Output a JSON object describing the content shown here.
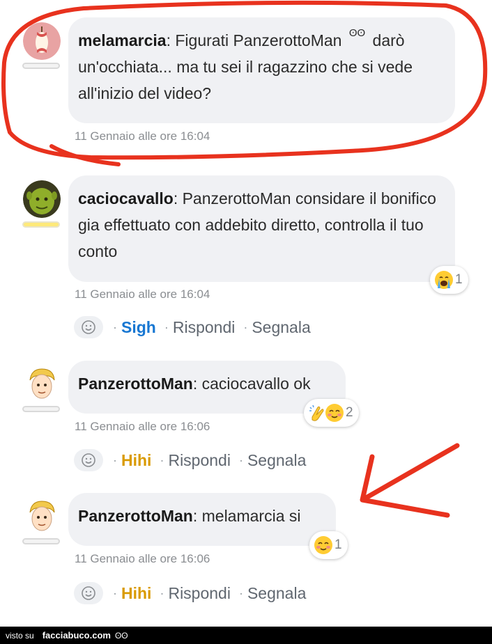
{
  "comments": [
    {
      "author": "melamarcia",
      "text_a": ": Figurati PanzerottoMan ",
      "eyes": "ʘʘ",
      "text_b": " darò un'occhiata... ma tu sei il ragazzino che si vede all'inizio del video?",
      "timestamp": "11 Gennaio alle ore 16:04"
    },
    {
      "author": "caciocavallo",
      "text": ": PanzerottoMan considare il bonifico gia effettuato con addebito diretto, controlla il tuo conto",
      "timestamp": "11 Gennaio alle ore 16:04",
      "reaction_count": "1",
      "reaction_emoji": "crying-face",
      "vote_label": "Sigh",
      "reply_label": "Rispondi",
      "report_label": "Segnala",
      "sep": "·"
    },
    {
      "author": "PanzerottoMan",
      "text": ": caciocavallo ok",
      "timestamp": "11 Gennaio alle ore 16:06",
      "reaction_count": "2",
      "reaction_emoji": [
        "clapping-hands",
        "blushing-face"
      ],
      "vote_label": "Hihi",
      "reply_label": "Rispondi",
      "report_label": "Segnala",
      "sep": "·"
    },
    {
      "author": "PanzerottoMan",
      "text": ": melamarcia si",
      "timestamp": "11 Gennaio alle ore 16:06",
      "reaction_count": "1",
      "reaction_emoji": "blushing-face",
      "vote_label": "Hihi",
      "reply_label": "Rispondi",
      "report_label": "Segnala",
      "sep": "·"
    }
  ],
  "footer": {
    "visto_su": "visto su",
    "brand": "facciabuco.com",
    "logo": "ʘʘ"
  },
  "colors": {
    "bubble": "#f0f1f4",
    "sigh": "#1877d2",
    "hihi": "#d99a00",
    "annotation_red": "#e8321e"
  }
}
